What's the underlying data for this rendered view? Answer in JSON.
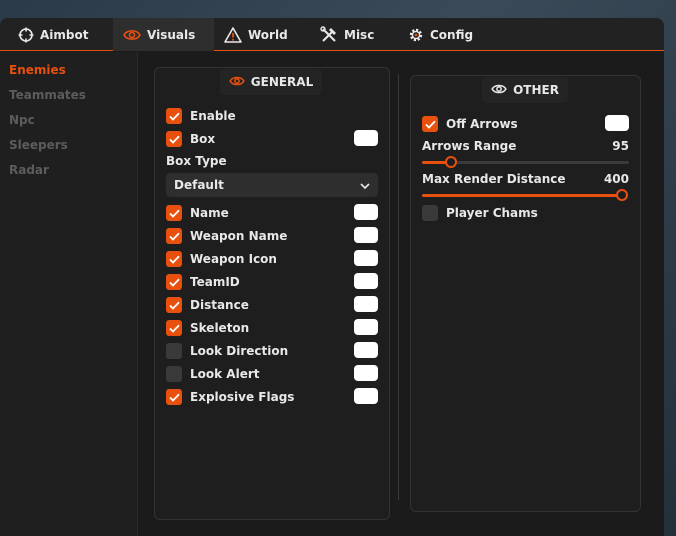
{
  "tabs": [
    {
      "label": "Aimbot",
      "icon": "crosshair-icon"
    },
    {
      "label": "Visuals",
      "icon": "eye-icon",
      "active": true
    },
    {
      "label": "World",
      "icon": "warning-triangle-icon"
    },
    {
      "label": "Misc",
      "icon": "tools-icon"
    },
    {
      "label": "Config",
      "icon": "gear-icon"
    }
  ],
  "sidebar": {
    "items": [
      {
        "label": "Enemies",
        "active": true
      },
      {
        "label": "Teammates"
      },
      {
        "label": "Npc"
      },
      {
        "label": "Sleepers"
      },
      {
        "label": "Radar"
      }
    ]
  },
  "general": {
    "title": "GENERAL",
    "enable": {
      "label": "Enable",
      "checked": true
    },
    "box": {
      "label": "Box",
      "checked": true
    },
    "box_type": {
      "label": "Box Type",
      "value": "Default"
    },
    "options": [
      {
        "label": "Name",
        "checked": true
      },
      {
        "label": "Weapon Name",
        "checked": true
      },
      {
        "label": "Weapon Icon",
        "checked": true
      },
      {
        "label": "TeamID",
        "checked": true
      },
      {
        "label": "Distance",
        "checked": true
      },
      {
        "label": "Skeleton",
        "checked": true
      },
      {
        "label": "Look Direction",
        "checked": false
      },
      {
        "label": "Look Alert",
        "checked": false
      },
      {
        "label": "Explosive Flags",
        "checked": true
      }
    ]
  },
  "other": {
    "title": "OTHER",
    "off_arrows": {
      "label": "Off Arrows",
      "checked": true
    },
    "arrows_range": {
      "label": "Arrows Range",
      "value": "95",
      "fraction": 0.14
    },
    "max_render_distance": {
      "label": "Max Render Distance",
      "value": "400",
      "fraction": 1.0
    },
    "player_chams": {
      "label": "Player Chams",
      "checked": false
    }
  },
  "colors": {
    "accent": "#e8500e",
    "swatch": "#ffffff"
  }
}
